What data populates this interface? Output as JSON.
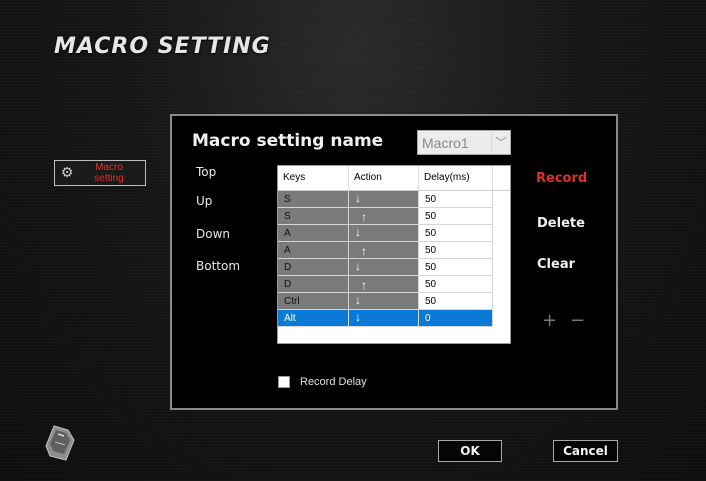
{
  "window": {
    "title": "MACRO SETTING"
  },
  "sidebar": {
    "button_label": "Macro setting",
    "icon": "gear-icon"
  },
  "macro": {
    "name_label": "Macro setting name",
    "selected_macro": "Macro1"
  },
  "navigation": {
    "top": "Top",
    "up": "Up",
    "down": "Down",
    "bottom": "Bottom"
  },
  "table": {
    "headers": [
      "Keys",
      "Action",
      "Delay(ms)"
    ],
    "rows": [
      {
        "key": "S",
        "action": "↓",
        "delay": "50"
      },
      {
        "key": "S",
        "action": "↑",
        "delay": "50"
      },
      {
        "key": "A",
        "action": "↓",
        "delay": "50"
      },
      {
        "key": "A",
        "action": "↑",
        "delay": "50"
      },
      {
        "key": "D",
        "action": "↓",
        "delay": "50"
      },
      {
        "key": "D",
        "action": "↑",
        "delay": "50"
      },
      {
        "key": "Ctrl",
        "action": "↓",
        "delay": "50"
      },
      {
        "key": "Alt",
        "action": "↓",
        "delay": "0"
      }
    ],
    "selected_row": 7
  },
  "actions": {
    "record": "Record",
    "delete": "Delete",
    "clear": "Clear",
    "plus": "+",
    "minus": "−"
  },
  "record_delay": {
    "label": "Record Delay",
    "checked": false
  },
  "footer": {
    "ok": "OK",
    "cancel": "Cancel"
  },
  "colors": {
    "accent_red": "#e0302a",
    "selection_blue": "#0a7ad6",
    "panel_bg": "#000000",
    "cell_gray": "#7a7a7a"
  }
}
